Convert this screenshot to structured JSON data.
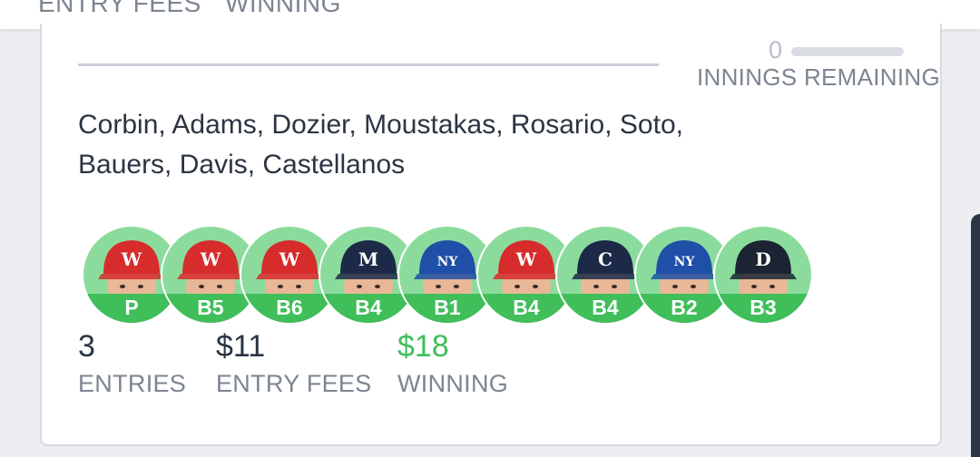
{
  "top_tabs": [
    "ENTRY FEES",
    "WINNING"
  ],
  "innings": {
    "count": "0",
    "label": "INNINGS REMAINING",
    "progress": 0
  },
  "lineup_progress": 0,
  "players_text": "Corbin, Adams, Dozier, Moustakas, Rosario, Soto, Bauers, Davis, Castellanos",
  "lineup": [
    {
      "position": "P",
      "team": "nationals",
      "cap_color": "#d62c2c",
      "logo": "W"
    },
    {
      "position": "B5",
      "team": "nationals",
      "cap_color": "#d62c2c",
      "logo": "W"
    },
    {
      "position": "B6",
      "team": "nationals",
      "cap_color": "#d62c2c",
      "logo": "W"
    },
    {
      "position": "B4",
      "team": "brewers",
      "cap_color": "#1c2a48",
      "logo": "M"
    },
    {
      "position": "B1",
      "team": "mets",
      "cap_color": "#1f4fa6",
      "logo": "NY"
    },
    {
      "position": "B4",
      "team": "nationals",
      "cap_color": "#d62c2c",
      "logo": "W"
    },
    {
      "position": "B4",
      "team": "indians",
      "cap_color": "#1c2a48",
      "logo": "C"
    },
    {
      "position": "B2",
      "team": "mets",
      "cap_color": "#1f4fa6",
      "logo": "NY"
    },
    {
      "position": "B3",
      "team": "tigers",
      "cap_color": "#1c2433",
      "logo": "D"
    }
  ],
  "stats": {
    "entries": {
      "value": "3",
      "label": "ENTRIES"
    },
    "entry_fees": {
      "value": "$11",
      "label": "ENTRY FEES"
    },
    "winning": {
      "value": "$18",
      "label": "WINNING"
    }
  },
  "colors": {
    "accent_green": "#3fbe5a",
    "avatar_bg": "#8bdc9c",
    "text_dark": "#2b3543",
    "text_muted": "#7c8591"
  }
}
